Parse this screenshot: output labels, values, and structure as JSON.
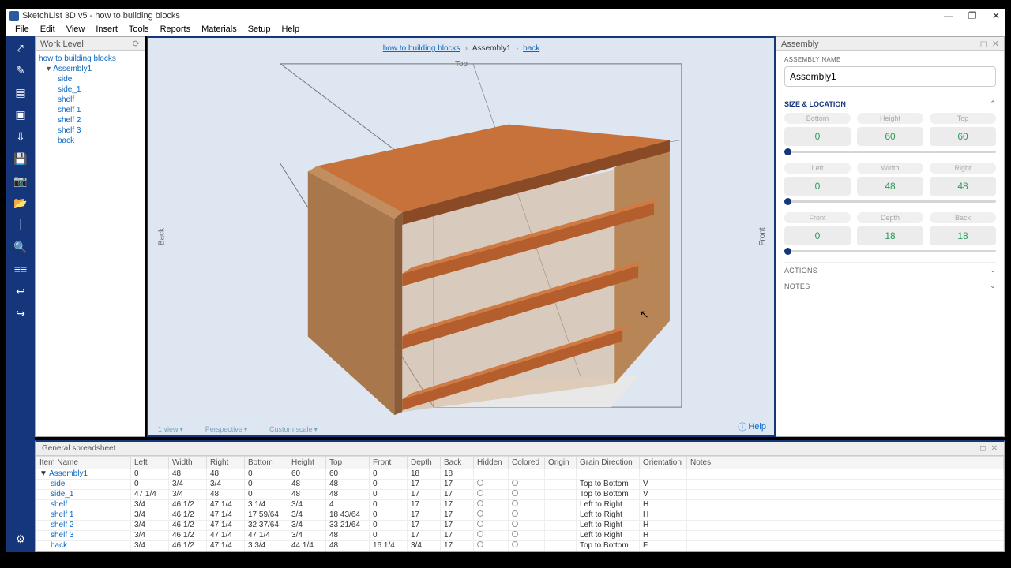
{
  "title": "SketchList 3D v5 - how to building blocks",
  "winctl": {
    "min": "—",
    "max": "❐",
    "close": "✕"
  },
  "menu": [
    "File",
    "Edit",
    "View",
    "Insert",
    "Tools",
    "Reports",
    "Materials",
    "Setup",
    "Help"
  ],
  "worklevel": {
    "title": "Work Level",
    "refresh": "⟳",
    "items": [
      {
        "lvl": 0,
        "text": "how to building blocks"
      },
      {
        "lvl": 1,
        "text": "Assembly1",
        "caret": "▼"
      },
      {
        "lvl": 2,
        "text": "side"
      },
      {
        "lvl": 2,
        "text": "side_1"
      },
      {
        "lvl": 2,
        "text": "shelf"
      },
      {
        "lvl": 2,
        "text": "shelf 1"
      },
      {
        "lvl": 2,
        "text": "shelf 2"
      },
      {
        "lvl": 2,
        "text": "shelf 3"
      },
      {
        "lvl": 2,
        "text": "back"
      }
    ]
  },
  "view": {
    "bc": [
      {
        "t": "how to building blocks",
        "link": true
      },
      {
        "t": "Assembly1",
        "link": false
      },
      {
        "t": "back",
        "link": true
      }
    ],
    "top": "Top",
    "back": "Back",
    "front": "Front",
    "status": [
      "1 view",
      "Perspective",
      "Custom scale"
    ],
    "help": "Help"
  },
  "inspector": {
    "title": "Assembly",
    "asm_lbl": "ASSEMBLY NAME",
    "asm_name": "Assembly1",
    "size_lbl": "SIZE & LOCATION",
    "rows": [
      {
        "a": "Bottom",
        "av": "0",
        "b": "Height",
        "bv": "60",
        "c": "Top",
        "cv": "60"
      },
      {
        "a": "Left",
        "av": "0",
        "b": "Width",
        "bv": "48",
        "c": "Right",
        "cv": "48"
      },
      {
        "a": "Front",
        "av": "0",
        "b": "Depth",
        "bv": "18",
        "c": "Back",
        "cv": "18"
      }
    ],
    "actions": "ACTIONS",
    "notes": "NOTES"
  },
  "sheet": {
    "title": "General spreadsheet",
    "headers": [
      "Item Name",
      "Left",
      "Width",
      "Right",
      "Bottom",
      "Height",
      "Top",
      "Front",
      "Depth",
      "Back",
      "Hidden",
      "Colored",
      "Origin",
      "Grain Direction",
      "Orientation",
      "Notes"
    ],
    "rows": [
      {
        "lvl": 0,
        "pre": "▼",
        "name": "Assembly1",
        "c": [
          "0",
          "48",
          "48",
          "0",
          "60",
          "60",
          "0",
          "18",
          "18",
          "",
          "",
          "",
          "",
          "",
          ""
        ]
      },
      {
        "lvl": 1,
        "name": "side",
        "c": [
          "0",
          "3/4",
          "3/4",
          "0",
          "48",
          "48",
          "0",
          "17",
          "17",
          "○",
          "○",
          "",
          "Top to Bottom",
          "V",
          ""
        ]
      },
      {
        "lvl": 1,
        "name": "side_1",
        "c": [
          "47 1/4",
          "3/4",
          "48",
          "0",
          "48",
          "48",
          "0",
          "17",
          "17",
          "○",
          "○",
          "",
          "Top to Bottom",
          "V",
          ""
        ]
      },
      {
        "lvl": 1,
        "name": "shelf",
        "c": [
          "3/4",
          "46 1/2",
          "47 1/4",
          "3 1/4",
          "3/4",
          "4",
          "0",
          "17",
          "17",
          "○",
          "○",
          "",
          "Left to Right",
          "H",
          ""
        ]
      },
      {
        "lvl": 1,
        "name": "shelf 1",
        "c": [
          "3/4",
          "46 1/2",
          "47 1/4",
          "17 59/64",
          "3/4",
          "18 43/64",
          "0",
          "17",
          "17",
          "○",
          "○",
          "",
          "Left to Right",
          "H",
          ""
        ]
      },
      {
        "lvl": 1,
        "name": "shelf 2",
        "c": [
          "3/4",
          "46 1/2",
          "47 1/4",
          "32 37/64",
          "3/4",
          "33 21/64",
          "0",
          "17",
          "17",
          "○",
          "○",
          "",
          "Left to Right",
          "H",
          ""
        ]
      },
      {
        "lvl": 1,
        "name": "shelf 3",
        "c": [
          "3/4",
          "46 1/2",
          "47 1/4",
          "47 1/4",
          "3/4",
          "48",
          "0",
          "17",
          "17",
          "○",
          "○",
          "",
          "Left to Right",
          "H",
          ""
        ]
      },
      {
        "lvl": 1,
        "name": "back",
        "c": [
          "3/4",
          "46 1/2",
          "47 1/4",
          "3 3/4",
          "44 1/4",
          "48",
          "16 1/4",
          "3/4",
          "17",
          "○",
          "○",
          "",
          "Top to Bottom",
          "F",
          ""
        ]
      }
    ]
  },
  "rail_icons": [
    "share",
    "pencil",
    "doc",
    "save",
    "import",
    "floppy",
    "camera",
    "open",
    "angle-l",
    "zoom",
    "align",
    "undo",
    "redo"
  ]
}
